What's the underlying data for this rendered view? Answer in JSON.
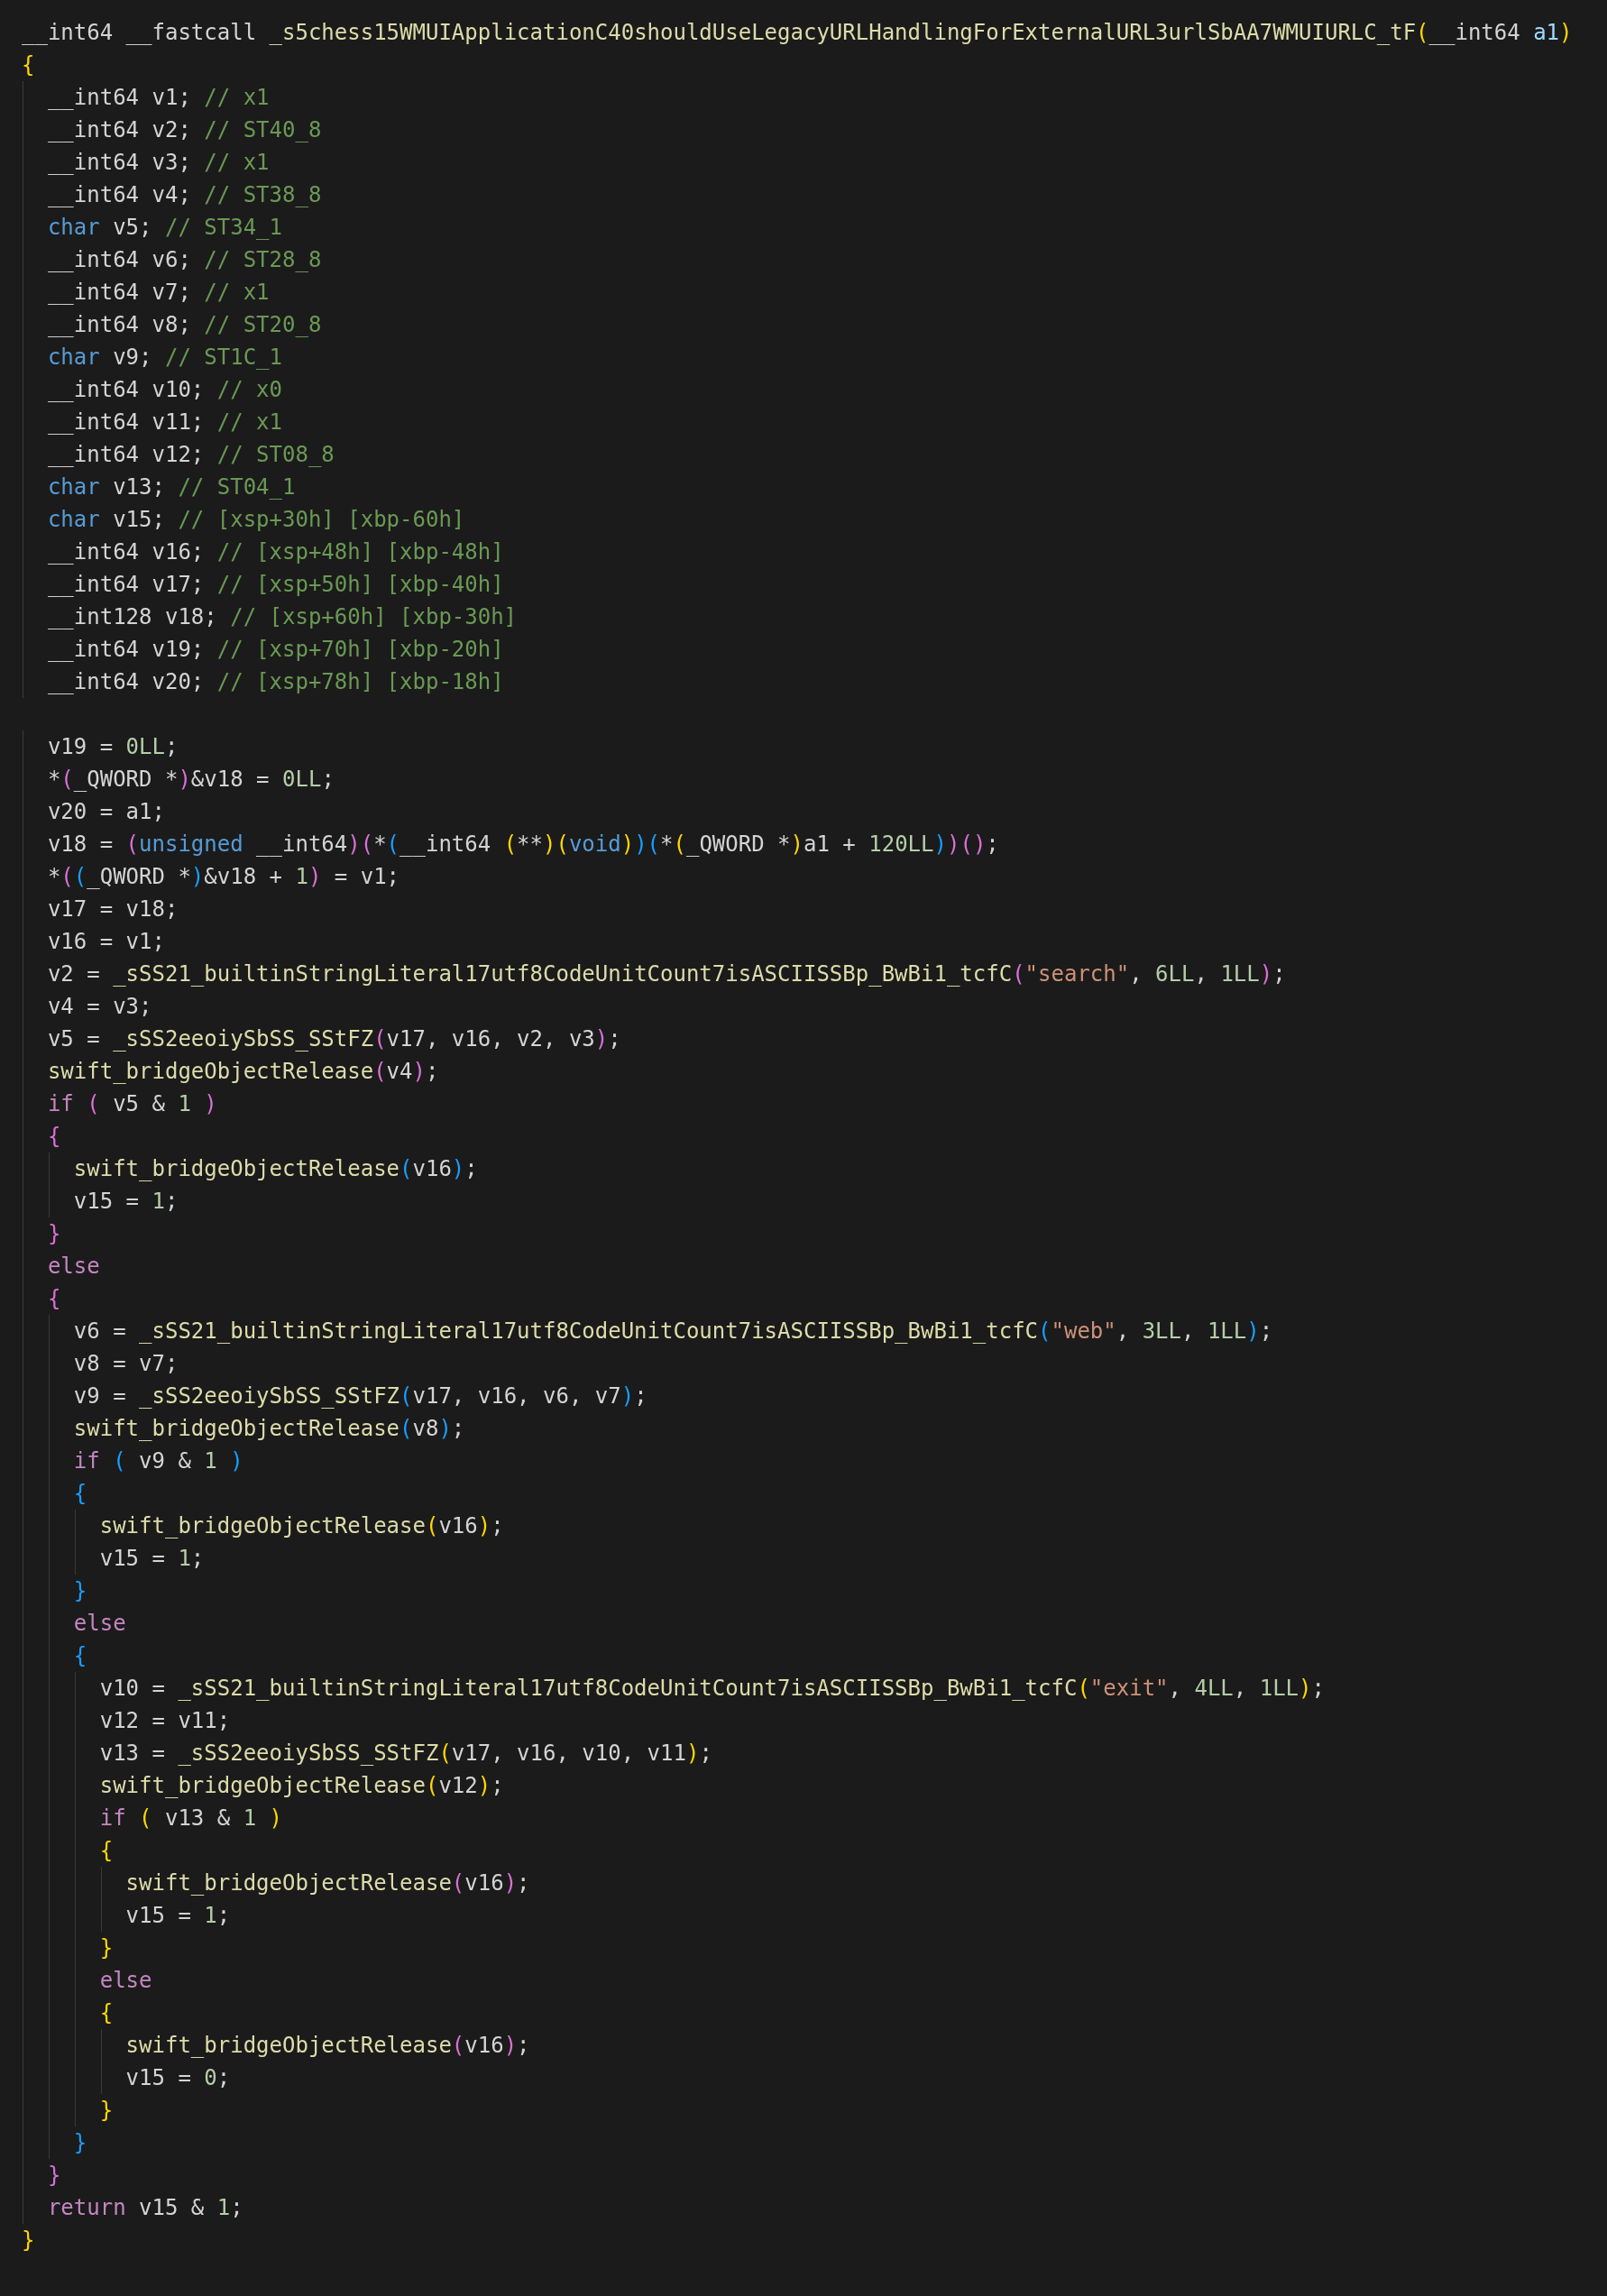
{
  "editor": {
    "lines": [
      {
        "kind": "code",
        "tokens": [
          {
            "kind": "plain",
            "text": "__int64 __fastcall "
          },
          {
            "kind": "func",
            "text": "_s5chess15WMUIApplicationC40shouldUseLegacyURLHandlingForExternalURL3urlSbAA7WMUIURLC_tF"
          },
          {
            "kind": "plain",
            "text": "(__int64 "
          },
          {
            "kind": "param",
            "text": "a1"
          },
          {
            "kind": "plain",
            "text": ")"
          }
        ]
      },
      {
        "kind": "code",
        "tokens": [
          {
            "kind": "plain",
            "text": "{"
          }
        ]
      },
      {
        "kind": "code",
        "tokens": [
          {
            "kind": "plain",
            "text": "  __int64 v1; "
          },
          {
            "kind": "comment",
            "text": "// x1"
          }
        ]
      },
      {
        "kind": "code",
        "tokens": [
          {
            "kind": "plain",
            "text": "  __int64 v2; "
          },
          {
            "kind": "comment",
            "text": "// ST40_8"
          }
        ]
      },
      {
        "kind": "code",
        "tokens": [
          {
            "kind": "plain",
            "text": "  __int64 v3; "
          },
          {
            "kind": "comment",
            "text": "// x1"
          }
        ]
      },
      {
        "kind": "code",
        "tokens": [
          {
            "kind": "plain",
            "text": "  __int64 v4; "
          },
          {
            "kind": "comment",
            "text": "// ST38_8"
          }
        ]
      },
      {
        "kind": "code",
        "tokens": [
          {
            "kind": "keyword",
            "text": "  char"
          },
          {
            "kind": "plain",
            "text": " v5; "
          },
          {
            "kind": "comment",
            "text": "// ST34_1"
          }
        ]
      },
      {
        "kind": "code",
        "tokens": [
          {
            "kind": "plain",
            "text": "  __int64 v6; "
          },
          {
            "kind": "comment",
            "text": "// ST28_8"
          }
        ]
      },
      {
        "kind": "code",
        "tokens": [
          {
            "kind": "plain",
            "text": "  __int64 v7; "
          },
          {
            "kind": "comment",
            "text": "// x1"
          }
        ]
      },
      {
        "kind": "code",
        "tokens": [
          {
            "kind": "plain",
            "text": "  __int64 v8; "
          },
          {
            "kind": "comment",
            "text": "// ST20_8"
          }
        ]
      },
      {
        "kind": "code",
        "tokens": [
          {
            "kind": "keyword",
            "text": "  char"
          },
          {
            "kind": "plain",
            "text": " v9; "
          },
          {
            "kind": "comment",
            "text": "// ST1C_1"
          }
        ]
      },
      {
        "kind": "code",
        "tokens": [
          {
            "kind": "plain",
            "text": "  __int64 v10; "
          },
          {
            "kind": "comment",
            "text": "// x0"
          }
        ]
      },
      {
        "kind": "code",
        "tokens": [
          {
            "kind": "plain",
            "text": "  __int64 v11; "
          },
          {
            "kind": "comment",
            "text": "// x1"
          }
        ]
      },
      {
        "kind": "code",
        "tokens": [
          {
            "kind": "plain",
            "text": "  __int64 v12; "
          },
          {
            "kind": "comment",
            "text": "// ST08_8"
          }
        ]
      },
      {
        "kind": "code",
        "tokens": [
          {
            "kind": "keyword",
            "text": "  char"
          },
          {
            "kind": "plain",
            "text": " v13; "
          },
          {
            "kind": "comment",
            "text": "// ST04_1"
          }
        ]
      },
      {
        "kind": "code",
        "tokens": [
          {
            "kind": "keyword",
            "text": "  char"
          },
          {
            "kind": "plain",
            "text": " v15; "
          },
          {
            "kind": "comment",
            "text": "// [xsp+30h] [xbp-60h]"
          }
        ]
      },
      {
        "kind": "code",
        "tokens": [
          {
            "kind": "plain",
            "text": "  __int64 v16; "
          },
          {
            "kind": "comment",
            "text": "// [xsp+48h] [xbp-48h]"
          }
        ]
      },
      {
        "kind": "code",
        "tokens": [
          {
            "kind": "plain",
            "text": "  __int64 v17; "
          },
          {
            "kind": "comment",
            "text": "// [xsp+50h] [xbp-40h]"
          }
        ]
      },
      {
        "kind": "code",
        "tokens": [
          {
            "kind": "plain",
            "text": "  __int128 v18; "
          },
          {
            "kind": "comment",
            "text": "// [xsp+60h] [xbp-30h]"
          }
        ]
      },
      {
        "kind": "code",
        "tokens": [
          {
            "kind": "plain",
            "text": "  __int64 v19; "
          },
          {
            "kind": "comment",
            "text": "// [xsp+70h] [xbp-20h]"
          }
        ]
      },
      {
        "kind": "code",
        "tokens": [
          {
            "kind": "plain",
            "text": "  __int64 v20; "
          },
          {
            "kind": "comment",
            "text": "// [xsp+78h] [xbp-18h]"
          }
        ]
      },
      {
        "kind": "blank"
      },
      {
        "kind": "code",
        "tokens": [
          {
            "kind": "plain",
            "text": "  v19 = "
          },
          {
            "kind": "number",
            "text": "0LL"
          },
          {
            "kind": "plain",
            "text": ";"
          }
        ]
      },
      {
        "kind": "code",
        "tokens": [
          {
            "kind": "plain",
            "text": "  *(_QWORD *)&v18 = "
          },
          {
            "kind": "number",
            "text": "0LL"
          },
          {
            "kind": "plain",
            "text": ";"
          }
        ]
      },
      {
        "kind": "code",
        "tokens": [
          {
            "kind": "plain",
            "text": "  v20 = a1;"
          }
        ]
      },
      {
        "kind": "code",
        "tokens": [
          {
            "kind": "plain",
            "text": "  v18 = ("
          },
          {
            "kind": "keyword",
            "text": "unsigned"
          },
          {
            "kind": "plain",
            "text": " __int64)(*(__int64 (**)("
          },
          {
            "kind": "keyword",
            "text": "void"
          },
          {
            "kind": "plain",
            "text": "))(*(_QWORD *)a1 + "
          },
          {
            "kind": "number",
            "text": "120LL"
          },
          {
            "kind": "plain",
            "text": "))();"
          }
        ]
      },
      {
        "kind": "code",
        "tokens": [
          {
            "kind": "plain",
            "text": "  *((_QWORD *)&v18 + "
          },
          {
            "kind": "number",
            "text": "1"
          },
          {
            "kind": "plain",
            "text": ") = v1;"
          }
        ]
      },
      {
        "kind": "code",
        "tokens": [
          {
            "kind": "plain",
            "text": "  v17 = v18;"
          }
        ]
      },
      {
        "kind": "code",
        "tokens": [
          {
            "kind": "plain",
            "text": "  v16 = v1;"
          }
        ]
      },
      {
        "kind": "code",
        "tokens": [
          {
            "kind": "plain",
            "text": "  v2 = "
          },
          {
            "kind": "func",
            "text": "_sSS21_builtinStringLiteral17utf8CodeUnitCount7isASCIISSBp_BwBi1_tcfC"
          },
          {
            "kind": "plain",
            "text": "("
          },
          {
            "kind": "string",
            "text": "\"search\""
          },
          {
            "kind": "plain",
            "text": ", "
          },
          {
            "kind": "number",
            "text": "6LL"
          },
          {
            "kind": "plain",
            "text": ", "
          },
          {
            "kind": "number",
            "text": "1LL"
          },
          {
            "kind": "plain",
            "text": ");"
          }
        ]
      },
      {
        "kind": "code",
        "tokens": [
          {
            "kind": "plain",
            "text": "  v4 = v3;"
          }
        ]
      },
      {
        "kind": "code",
        "tokens": [
          {
            "kind": "plain",
            "text": "  v5 = "
          },
          {
            "kind": "func",
            "text": "_sSS2eeoiySbSS_SStFZ"
          },
          {
            "kind": "plain",
            "text": "(v17, v16, v2, v3);"
          }
        ]
      },
      {
        "kind": "code",
        "tokens": [
          {
            "kind": "func",
            "text": "  swift_bridgeObjectRelease"
          },
          {
            "kind": "plain",
            "text": "(v4);"
          }
        ]
      },
      {
        "kind": "code",
        "tokens": [
          {
            "kind": "control",
            "text": "  if"
          },
          {
            "kind": "plain",
            "text": " ( v5 & "
          },
          {
            "kind": "number",
            "text": "1"
          },
          {
            "kind": "plain",
            "text": " )"
          }
        ]
      },
      {
        "kind": "code",
        "tokens": [
          {
            "kind": "plain",
            "text": "  {"
          }
        ]
      },
      {
        "kind": "code",
        "tokens": [
          {
            "kind": "func",
            "text": "    swift_bridgeObjectRelease"
          },
          {
            "kind": "plain",
            "text": "(v16);"
          }
        ]
      },
      {
        "kind": "code",
        "tokens": [
          {
            "kind": "plain",
            "text": "    v15 = "
          },
          {
            "kind": "number",
            "text": "1"
          },
          {
            "kind": "plain",
            "text": ";"
          }
        ]
      },
      {
        "kind": "code",
        "tokens": [
          {
            "kind": "plain",
            "text": "  }"
          }
        ]
      },
      {
        "kind": "code",
        "tokens": [
          {
            "kind": "control",
            "text": "  else"
          }
        ]
      },
      {
        "kind": "code",
        "tokens": [
          {
            "kind": "plain",
            "text": "  {"
          }
        ]
      },
      {
        "kind": "code",
        "tokens": [
          {
            "kind": "plain",
            "text": "    v6 = "
          },
          {
            "kind": "func",
            "text": "_sSS21_builtinStringLiteral17utf8CodeUnitCount7isASCIISSBp_BwBi1_tcfC"
          },
          {
            "kind": "plain",
            "text": "("
          },
          {
            "kind": "string",
            "text": "\"web\""
          },
          {
            "kind": "plain",
            "text": ", "
          },
          {
            "kind": "number",
            "text": "3LL"
          },
          {
            "kind": "plain",
            "text": ", "
          },
          {
            "kind": "number",
            "text": "1LL"
          },
          {
            "kind": "plain",
            "text": ");"
          }
        ]
      },
      {
        "kind": "code",
        "tokens": [
          {
            "kind": "plain",
            "text": "    v8 = v7;"
          }
        ]
      },
      {
        "kind": "code",
        "tokens": [
          {
            "kind": "plain",
            "text": "    v9 = "
          },
          {
            "kind": "func",
            "text": "_sSS2eeoiySbSS_SStFZ"
          },
          {
            "kind": "plain",
            "text": "(v17, v16, v6, v7);"
          }
        ]
      },
      {
        "kind": "code",
        "tokens": [
          {
            "kind": "func",
            "text": "    swift_bridgeObjectRelease"
          },
          {
            "kind": "plain",
            "text": "(v8);"
          }
        ]
      },
      {
        "kind": "code",
        "tokens": [
          {
            "kind": "control",
            "text": "    if"
          },
          {
            "kind": "plain",
            "text": " ( v9 & "
          },
          {
            "kind": "number",
            "text": "1"
          },
          {
            "kind": "plain",
            "text": " )"
          }
        ]
      },
      {
        "kind": "code",
        "tokens": [
          {
            "kind": "plain",
            "text": "    {"
          }
        ]
      },
      {
        "kind": "code",
        "tokens": [
          {
            "kind": "func",
            "text": "      swift_bridgeObjectRelease"
          },
          {
            "kind": "plain",
            "text": "(v16);"
          }
        ]
      },
      {
        "kind": "code",
        "tokens": [
          {
            "kind": "plain",
            "text": "      v15 = "
          },
          {
            "kind": "number",
            "text": "1"
          },
          {
            "kind": "plain",
            "text": ";"
          }
        ]
      },
      {
        "kind": "code",
        "tokens": [
          {
            "kind": "plain",
            "text": "    }"
          }
        ]
      },
      {
        "kind": "code",
        "tokens": [
          {
            "kind": "control",
            "text": "    else"
          }
        ]
      },
      {
        "kind": "code",
        "tokens": [
          {
            "kind": "plain",
            "text": "    {"
          }
        ]
      },
      {
        "kind": "code",
        "tokens": [
          {
            "kind": "plain",
            "text": "      v10 = "
          },
          {
            "kind": "func",
            "text": "_sSS21_builtinStringLiteral17utf8CodeUnitCount7isASCIISSBp_BwBi1_tcfC"
          },
          {
            "kind": "plain",
            "text": "("
          },
          {
            "kind": "string",
            "text": "\"exit\""
          },
          {
            "kind": "plain",
            "text": ", "
          },
          {
            "kind": "number",
            "text": "4LL"
          },
          {
            "kind": "plain",
            "text": ", "
          },
          {
            "kind": "number",
            "text": "1LL"
          },
          {
            "kind": "plain",
            "text": ");"
          }
        ]
      },
      {
        "kind": "code",
        "tokens": [
          {
            "kind": "plain",
            "text": "      v12 = v11;"
          }
        ]
      },
      {
        "kind": "code",
        "tokens": [
          {
            "kind": "plain",
            "text": "      v13 = "
          },
          {
            "kind": "func",
            "text": "_sSS2eeoiySbSS_SStFZ"
          },
          {
            "kind": "plain",
            "text": "(v17, v16, v10, v11);"
          }
        ]
      },
      {
        "kind": "code",
        "tokens": [
          {
            "kind": "func",
            "text": "      swift_bridgeObjectRelease"
          },
          {
            "kind": "plain",
            "text": "(v12);"
          }
        ]
      },
      {
        "kind": "code",
        "tokens": [
          {
            "kind": "control",
            "text": "      if"
          },
          {
            "kind": "plain",
            "text": " ( v13 & "
          },
          {
            "kind": "number",
            "text": "1"
          },
          {
            "kind": "plain",
            "text": " )"
          }
        ]
      },
      {
        "kind": "code",
        "tokens": [
          {
            "kind": "plain",
            "text": "      {"
          }
        ]
      },
      {
        "kind": "code",
        "tokens": [
          {
            "kind": "func",
            "text": "        swift_bridgeObjectRelease"
          },
          {
            "kind": "plain",
            "text": "(v16);"
          }
        ]
      },
      {
        "kind": "code",
        "tokens": [
          {
            "kind": "plain",
            "text": "        v15 = "
          },
          {
            "kind": "number",
            "text": "1"
          },
          {
            "kind": "plain",
            "text": ";"
          }
        ]
      },
      {
        "kind": "code",
        "tokens": [
          {
            "kind": "plain",
            "text": "      }"
          }
        ]
      },
      {
        "kind": "code",
        "tokens": [
          {
            "kind": "control",
            "text": "      else"
          }
        ]
      },
      {
        "kind": "code",
        "tokens": [
          {
            "kind": "plain",
            "text": "      {"
          }
        ]
      },
      {
        "kind": "code",
        "tokens": [
          {
            "kind": "func",
            "text": "        swift_bridgeObjectRelease"
          },
          {
            "kind": "plain",
            "text": "(v16);"
          }
        ]
      },
      {
        "kind": "code",
        "tokens": [
          {
            "kind": "plain",
            "text": "        v15 = "
          },
          {
            "kind": "number",
            "text": "0"
          },
          {
            "kind": "plain",
            "text": ";"
          }
        ]
      },
      {
        "kind": "code",
        "tokens": [
          {
            "kind": "plain",
            "text": "      }"
          }
        ]
      },
      {
        "kind": "code",
        "tokens": [
          {
            "kind": "plain",
            "text": "    }"
          }
        ]
      },
      {
        "kind": "code",
        "tokens": [
          {
            "kind": "plain",
            "text": "  }"
          }
        ]
      },
      {
        "kind": "code",
        "tokens": [
          {
            "kind": "control",
            "text": "  return"
          },
          {
            "kind": "plain",
            "text": " v15 & "
          },
          {
            "kind": "number",
            "text": "1"
          },
          {
            "kind": "plain",
            "text": ";"
          }
        ]
      },
      {
        "kind": "code",
        "tokens": [
          {
            "kind": "plain",
            "text": "}"
          }
        ]
      }
    ]
  }
}
